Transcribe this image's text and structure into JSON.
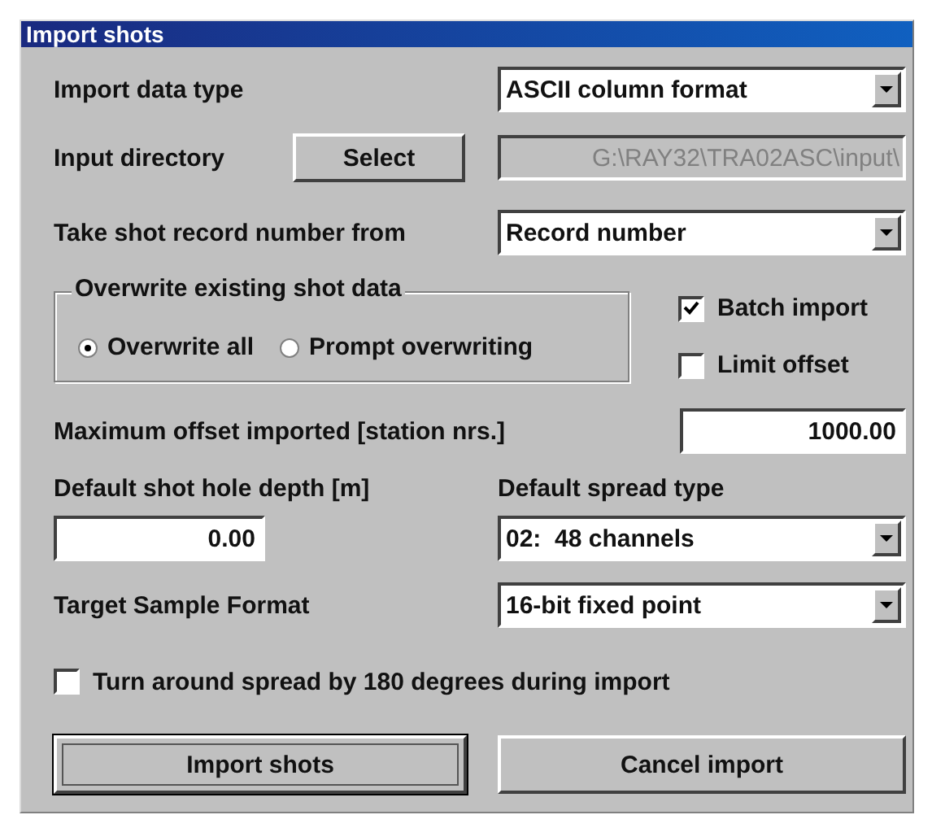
{
  "window": {
    "title": "Import shots"
  },
  "import_data_type": {
    "label": "Import data type",
    "value": "ASCII column format"
  },
  "input_directory": {
    "label": "Input directory",
    "button": "Select",
    "value": "G:\\RAY32\\TRA02ASC\\input\\",
    "disabled": true
  },
  "record_number": {
    "label": "Take shot record number from",
    "value": "Record number"
  },
  "overwrite_group": {
    "title": "Overwrite existing shot data",
    "options": [
      {
        "label": "Overwrite all",
        "selected": true
      },
      {
        "label": "Prompt overwriting",
        "selected": false
      }
    ]
  },
  "side_checkboxes": [
    {
      "label": "Batch import",
      "checked": true
    },
    {
      "label": "Limit offset",
      "checked": false
    }
  ],
  "max_offset": {
    "label": "Maximum offset imported [station nrs.]",
    "value": "1000.00"
  },
  "shot_hole_depth": {
    "label": "Default shot hole depth [m]",
    "value": "0.00"
  },
  "spread_type": {
    "label": "Default spread type",
    "value": "02:  48 channels"
  },
  "sample_format": {
    "label": "Target Sample Format",
    "value": "16-bit fixed point"
  },
  "turn_around": {
    "label": "Turn around spread by 180 degrees during import",
    "checked": false
  },
  "buttons": [
    {
      "label": "Import shots",
      "default": true
    },
    {
      "label": "Cancel import",
      "default": false
    }
  ]
}
